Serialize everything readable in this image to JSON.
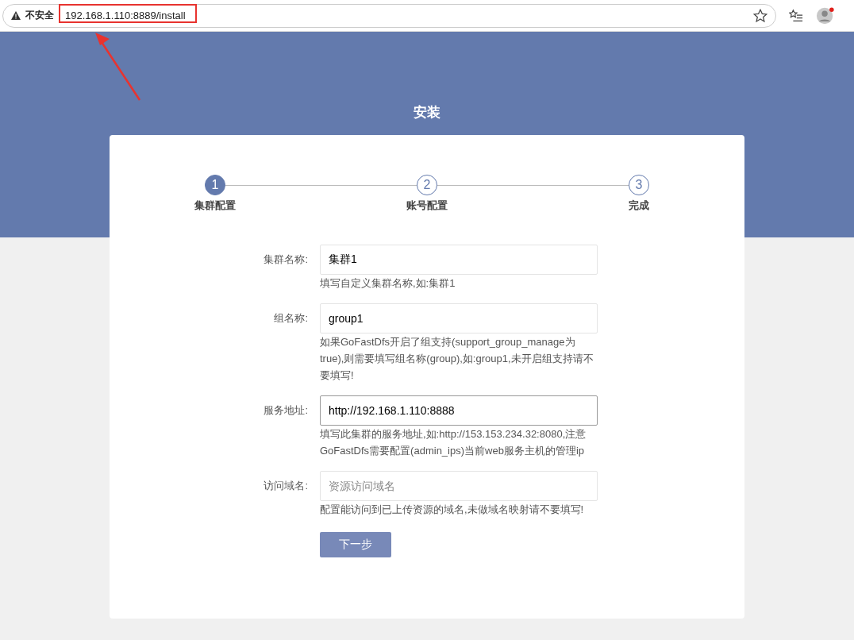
{
  "browser": {
    "security_label": "不安全",
    "url": "192.168.1.110:8889/install"
  },
  "page": {
    "title": "安装"
  },
  "steps": [
    {
      "number": "1",
      "label": "集群配置",
      "selected": true
    },
    {
      "number": "2",
      "label": "账号配置",
      "selected": false
    },
    {
      "number": "3",
      "label": "完成",
      "selected": false
    }
  ],
  "fields": [
    {
      "label": "集群名称:",
      "value": "集群1",
      "focused": false,
      "help": "填写自定义集群名称,如:集群1"
    },
    {
      "label": "组名称:",
      "value": "group1",
      "focused": false,
      "help": "如果GoFastDfs开启了组支持(support_group_manage为true),则需要填写组名称(group),如:group1,未开启组支持请不要填写!"
    },
    {
      "label": "服务地址:",
      "value": "http://192.168.1.110:8888",
      "focused": true,
      "help": "填写此集群的服务地址,如:http://153.153.234.32:8080,注意GoFastDfs需要配置(admin_ips)当前web服务主机的管理ip"
    },
    {
      "label": "访问域名:",
      "placeholder": "资源访问域名",
      "focused": false,
      "help": "配置能访问到已上传资源的域名,未做域名映射请不要填写!"
    }
  ],
  "next_button": "下一步"
}
